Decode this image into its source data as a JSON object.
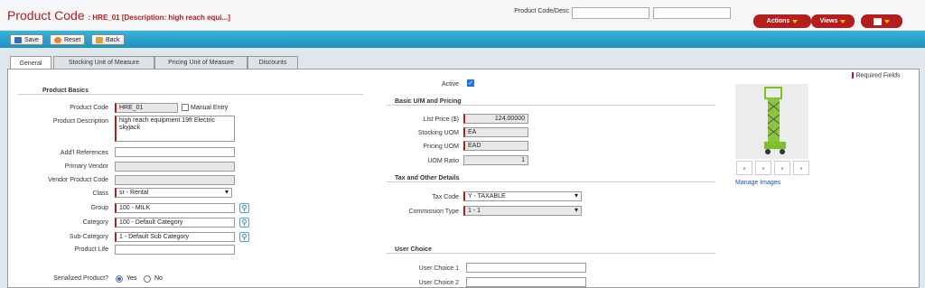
{
  "header": {
    "title": "Product Code",
    "subtitle": ": HRE_01 [Description: high reach equi...]",
    "search_label": "Product Code/Desc",
    "actions": "Actions",
    "views": "Views"
  },
  "toolbar": {
    "save": "Save",
    "reset": "Reset",
    "back": "Back"
  },
  "tabs": [
    "General",
    "Stocking Unit of Measure",
    "Pricing Unit of Measure",
    "Discounts"
  ],
  "required_label": "Required Fields",
  "basics": {
    "heading": "Product Basics",
    "product_code_label": "Product Code",
    "product_code": "HRE_01",
    "manual_entry": "Manual Entry",
    "description_label": "Product Description",
    "description": "high reach equipment 19ft Electric skyjack",
    "add_refs_label": "Add'l References",
    "primary_vendor_label": "Primary Vendor",
    "vendor_code_label": "Vendor Product Code",
    "class_label": "Class",
    "class": "sr - Rental",
    "group_label": "Group",
    "group": "100 - MILK",
    "category_label": "Category",
    "category": "100 - Default Category",
    "subcategory_label": "Sub-Category",
    "subcategory": "1 - Default Sub Category",
    "life_label": "Product Life",
    "serialized_label": "Serialized Product?",
    "yes": "Yes",
    "no": "No"
  },
  "active_label": "Active",
  "uom": {
    "heading": "Basic U/M and Pricing",
    "list_price_label": "List Price ($)",
    "list_price": "124.00000",
    "stocking_label": "Stocking UOM",
    "stocking": "EA",
    "pricing_label": "Pricing UOM",
    "pricing": "EAD",
    "ratio_label": "UOM Ratio",
    "ratio": "1"
  },
  "tax": {
    "heading": "Tax and Other Details",
    "tax_code_label": "Tax Code",
    "tax_code": "Y - TAXABLE",
    "commission_label": "Commission Type",
    "commission": "1 - 1"
  },
  "user_choice": {
    "heading": "User Choice",
    "choice1_label": "User Choice 1",
    "choice2_label": "User Choice 2"
  },
  "images": {
    "manage": "Manage Images"
  },
  "colors": {
    "accent": "#b01e1e",
    "toolbar": "#1c92bf"
  }
}
